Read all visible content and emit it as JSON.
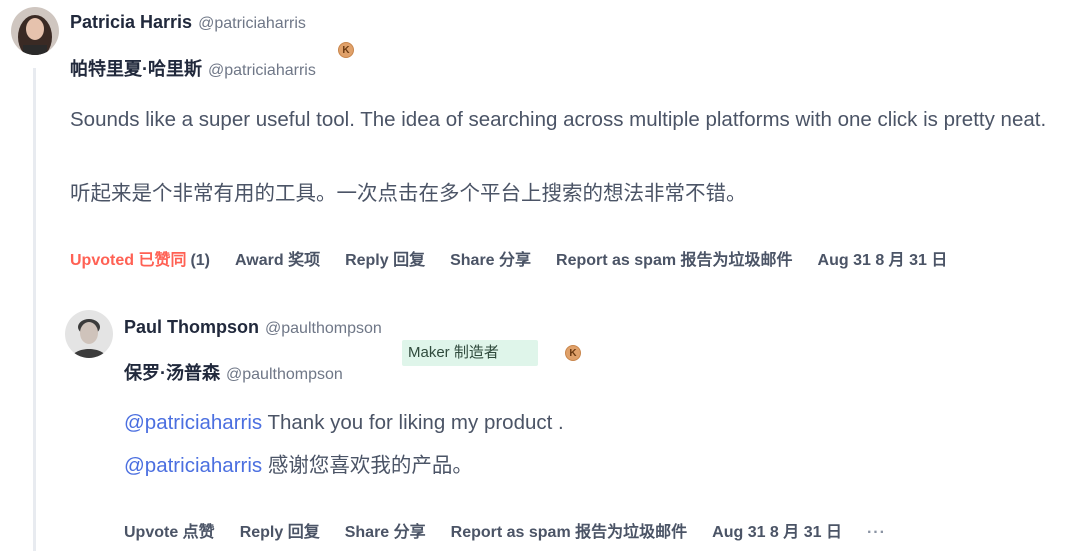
{
  "comment1": {
    "author_name": "Patricia Harris",
    "author_handle": "@patriciaharris",
    "author_name_zh": "帕特里夏·哈里斯",
    "author_handle_zh": "@patriciaharris",
    "karma_badge": "K",
    "text_en": "Sounds like a super useful tool. The idea of searching across multiple platforms with one click is pretty neat.",
    "text_zh": "听起来是个非常有用的工具。一次点击在多个平台上搜索的想法非常不错。",
    "actions": {
      "upvoted_label": "Upvoted 已赞同",
      "upvote_count": "(1)",
      "award": "Award 奖项",
      "reply": "Reply 回复",
      "share": "Share 分享",
      "report": "Report as spam 报告为垃圾邮件",
      "date": "Aug 31 8 月 31 日"
    }
  },
  "comment2": {
    "author_name": "Paul Thompson",
    "author_handle": "@paulthompson",
    "author_name_zh": "保罗·汤普森",
    "author_handle_zh": "@paulthompson",
    "maker_badge": "Maker 制造者",
    "karma_badge": "K",
    "mention": "@patriciaharris",
    "text_en": " Thank you for liking my product .",
    "text_zh": " 感谢您喜欢我的产品。",
    "actions": {
      "upvote": "Upvote 点赞",
      "reply": "Reply 回复",
      "share": "Share 分享",
      "report": "Report as spam 报告为垃圾邮件",
      "date": "Aug 31 8 月 31 日",
      "more": "···"
    }
  },
  "colors": {
    "accent": "#ff6154",
    "mention": "#4b6fe0",
    "maker_bg": "#dff5ea",
    "karma": "#e0a16a"
  }
}
